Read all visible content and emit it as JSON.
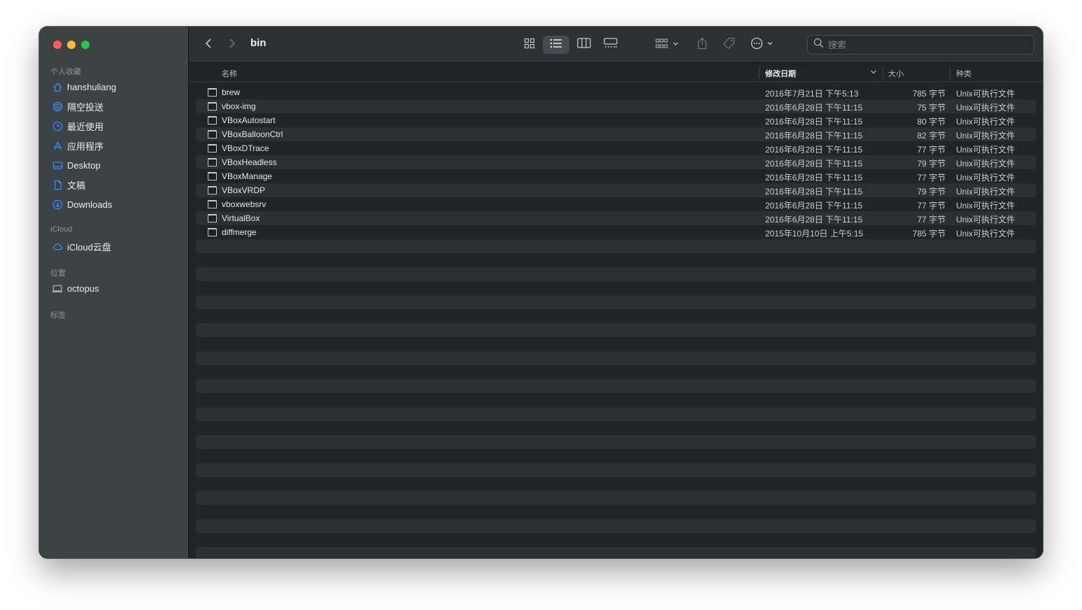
{
  "window": {
    "title": "bin",
    "colors": {
      "sidebar_bg": "#3d4244",
      "content_bg": "#1f2628",
      "accent": "#3b8cf5"
    }
  },
  "sidebar": {
    "favorites_header": "个人收藏",
    "favorites": [
      {
        "label": "hanshuliang",
        "icon": "home-icon"
      },
      {
        "label": "隔空投送",
        "icon": "airdrop-icon"
      },
      {
        "label": "最近使用",
        "icon": "clock-icon"
      },
      {
        "label": "应用程序",
        "icon": "applications-icon"
      },
      {
        "label": "Desktop",
        "icon": "desktop-icon"
      },
      {
        "label": "文稿",
        "icon": "document-icon"
      },
      {
        "label": "Downloads",
        "icon": "downloads-icon"
      }
    ],
    "icloud_header": "iCloud",
    "icloud": [
      {
        "label": "iCloud云盘",
        "icon": "cloud-icon"
      }
    ],
    "locations_header": "位置",
    "locations": [
      {
        "label": "octopus",
        "icon": "laptop-icon"
      }
    ],
    "tags_header": "标签"
  },
  "toolbar": {
    "search_placeholder": "搜索",
    "icons": [
      "back-icon",
      "forward-icon",
      "icon-view-icon",
      "list-view-icon",
      "column-view-icon",
      "gallery-view-icon",
      "group-icon",
      "share-icon",
      "tag-icon",
      "more-icon",
      "search-icon"
    ]
  },
  "columns": {
    "name": "名称",
    "date": "修改日期",
    "size": "大小",
    "kind": "种类"
  },
  "files": [
    {
      "name": "brew",
      "date": "2016年7月21日 下午5:13",
      "size": "785 字节",
      "kind": "Unix可执行文件"
    },
    {
      "name": "vbox-img",
      "date": "2016年6月28日 下午11:15",
      "size": "75 字节",
      "kind": "Unix可执行文件"
    },
    {
      "name": "VBoxAutostart",
      "date": "2016年6月28日 下午11:15",
      "size": "80 字节",
      "kind": "Unix可执行文件"
    },
    {
      "name": "VBoxBalloonCtrl",
      "date": "2016年6月28日 下午11:15",
      "size": "82 字节",
      "kind": "Unix可执行文件"
    },
    {
      "name": "VBoxDTrace",
      "date": "2016年6月28日 下午11:15",
      "size": "77 字节",
      "kind": "Unix可执行文件"
    },
    {
      "name": "VBoxHeadless",
      "date": "2016年6月28日 下午11:15",
      "size": "79 字节",
      "kind": "Unix可执行文件"
    },
    {
      "name": "VBoxManage",
      "date": "2016年6月28日 下午11:15",
      "size": "77 字节",
      "kind": "Unix可执行文件"
    },
    {
      "name": "VBoxVRDP",
      "date": "2016年6月28日 下午11:15",
      "size": "79 字节",
      "kind": "Unix可执行文件"
    },
    {
      "name": "vboxwebsrv",
      "date": "2016年6月28日 下午11:15",
      "size": "77 字节",
      "kind": "Unix可执行文件"
    },
    {
      "name": "VirtualBox",
      "date": "2016年6月28日 下午11:15",
      "size": "77 字节",
      "kind": "Unix可执行文件"
    },
    {
      "name": "diffmerge",
      "date": "2015年10月10日 上午5:15",
      "size": "785 字节",
      "kind": "Unix可执行文件"
    }
  ]
}
